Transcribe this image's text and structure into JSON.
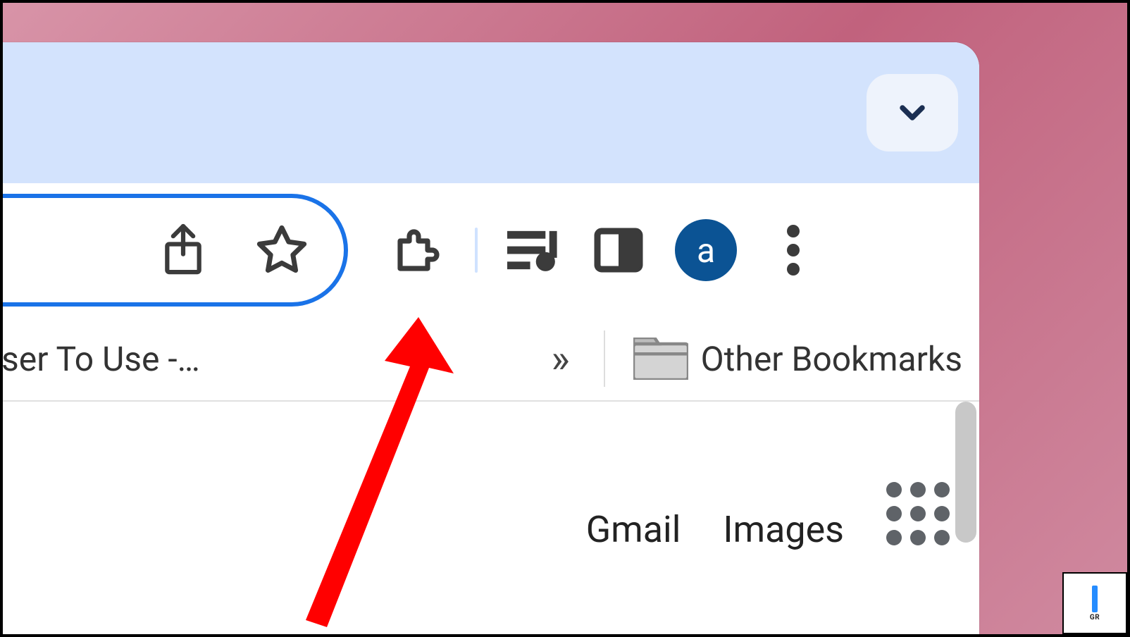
{
  "profile": {
    "initial": "a"
  },
  "bookmarks": {
    "left_item": "ser To Use -…",
    "overflow_glyph": "»",
    "other_label": "Other Bookmarks"
  },
  "newtab": {
    "gmail": "Gmail",
    "images": "Images"
  },
  "corner": {
    "label": "GR"
  }
}
